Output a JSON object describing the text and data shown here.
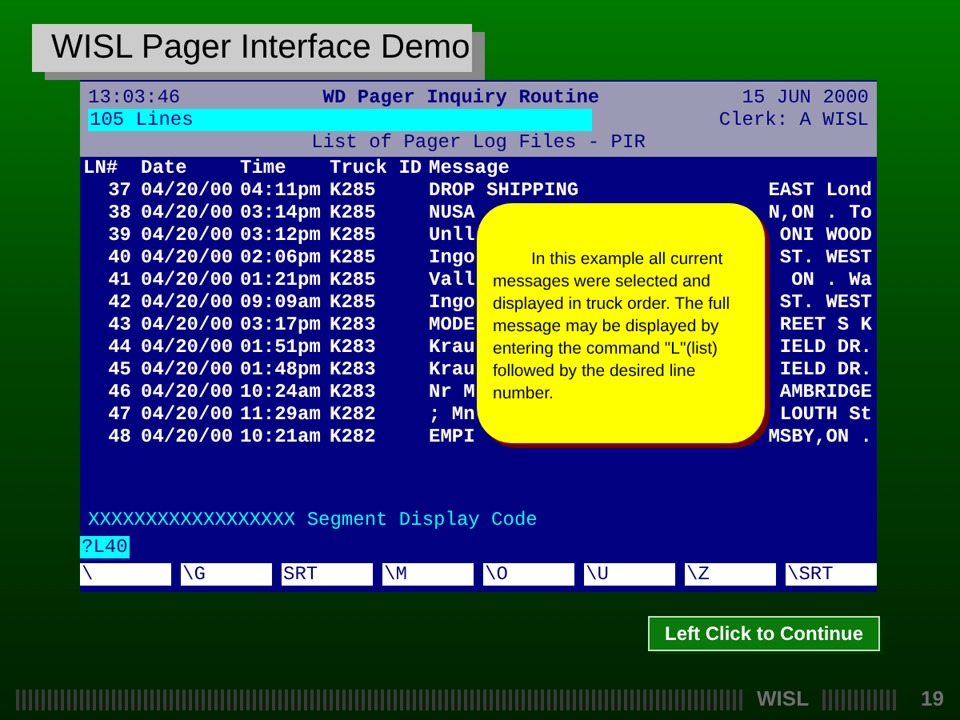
{
  "slide_title": "WISL Pager Interface Demo",
  "terminal": {
    "clock": "13:03:46",
    "routine_title": "WD Pager Inquiry Routine",
    "date": "15 JUN 2000",
    "line_count": "105 Lines",
    "clerk": "Clerk: A WISL",
    "list_title": "List of Pager Log Files - PIR",
    "columns": [
      "LN#",
      "Date",
      "Time",
      "Truck ID",
      "Message"
    ],
    "rows": [
      {
        "ln": "37",
        "date": "04/20/00",
        "time": "04:11pm",
        "truck": "K285",
        "message_start": "DROP SHIPPING",
        "message_end": "EAST Lond"
      },
      {
        "ln": "38",
        "date": "04/20/00",
        "time": "03:14pm",
        "truck": "K285",
        "message_start": "NUSA",
        "message_end": "N,ON . To"
      },
      {
        "ln": "39",
        "date": "04/20/00",
        "time": "03:12pm",
        "truck": "K285",
        "message_start": "Unll",
        "message_end": "ONI WOOD"
      },
      {
        "ln": "40",
        "date": "04/20/00",
        "time": "02:06pm",
        "truck": "K285",
        "message_start": "Ingo",
        "message_end": "ST. WEST"
      },
      {
        "ln": "41",
        "date": "04/20/00",
        "time": "01:21pm",
        "truck": "K285",
        "message_start": "Vall",
        "message_end": "ON . Wa"
      },
      {
        "ln": "42",
        "date": "04/20/00",
        "time": "09:09am",
        "truck": "K285",
        "message_start": "Ingo",
        "message_end": "ST. WEST"
      },
      {
        "ln": "43",
        "date": "04/20/00",
        "time": "03:17pm",
        "truck": "K283",
        "message_start": "MODE",
        "message_end": "REET S K"
      },
      {
        "ln": "44",
        "date": "04/20/00",
        "time": "01:51pm",
        "truck": "K283",
        "message_start": "Krau",
        "message_end": "IELD DR."
      },
      {
        "ln": "45",
        "date": "04/20/00",
        "time": "01:48pm",
        "truck": "K283",
        "message_start": "Krau",
        "message_end": "IELD DR."
      },
      {
        "ln": "46",
        "date": "04/20/00",
        "time": "10:24am",
        "truck": "K283",
        "message_start": "Nr M",
        "message_end": "AMBRIDGE"
      },
      {
        "ln": "47",
        "date": "04/20/00",
        "time": "11:29am",
        "truck": "K282",
        "message_start": "; Mn",
        "message_end": "LOUTH St"
      },
      {
        "ln": "48",
        "date": "04/20/00",
        "time": "10:21am",
        "truck": "K282",
        "message_start": "EMPI",
        "message_end": "MSBY,ON ."
      }
    ],
    "segment_label": "XXXXXXXXXXXXXXXXXX Segment Display Code",
    "command": "?L40",
    "function_keys": [
      "\\",
      "\\G",
      "SRT",
      "\\M",
      "\\O",
      "\\U",
      "\\Z",
      "\\SRT"
    ]
  },
  "callout": "In this example all current messages were selected and displayed in truck order. The full message may be displayed by entering the command \"L\"(list) followed by the desired line number.",
  "continue_button": "Left Click to Continue",
  "footer": {
    "brand": "WISL",
    "page": "19"
  }
}
